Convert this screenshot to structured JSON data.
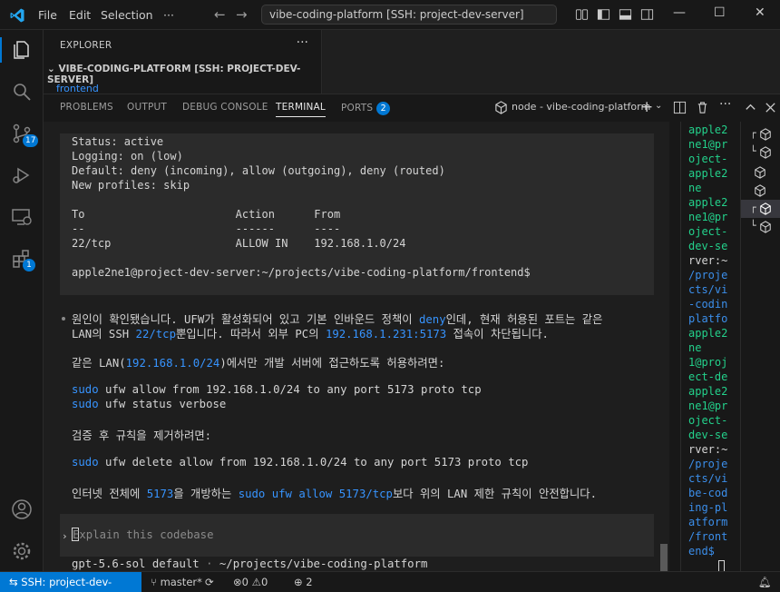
{
  "titlebar": {
    "menu": [
      "File",
      "Edit",
      "Selection"
    ],
    "more": "···",
    "search": "vibe-coding-platform [SSH: project-dev-server]"
  },
  "activity": {
    "scm_badge": "17",
    "ext_badge": "1"
  },
  "sidebar": {
    "header": "EXPLORER",
    "more": "···",
    "project": "VIBE-CODING-PLATFORM [SSH: PROJECT-DEV-SERVER]",
    "folder": "frontend"
  },
  "panel": {
    "tabs": [
      {
        "label": "PROBLEMS"
      },
      {
        "label": "OUTPUT"
      },
      {
        "label": "DEBUG CONSOLE"
      },
      {
        "label": "TERMINAL"
      },
      {
        "label": "PORTS",
        "count": "2"
      }
    ],
    "terminal_name": "node - vibe-coding-platform"
  },
  "content": {
    "codeblock": [
      "Status: active",
      "Logging: on (low)",
      "Default: deny (incoming), allow (outgoing), deny (routed)",
      "New profiles: skip",
      "",
      "To                       Action      From",
      "--                       ------      ----",
      "22/tcp                   ALLOW IN    192.168.1.0/24",
      "",
      "apple2ne1@project-dev-server:~/projects/vibe-coding-platform/frontend$"
    ],
    "p1_a": "원인이 확인됐습니다. UFW가 활성화되어 있고 기본 인바운드 정책이 ",
    "p1_hl1": "deny",
    "p1_b": "인데, 현재 허용된 포트는 같은",
    "p2_a": "LAN의 SSH ",
    "p2_hl1": "22/tcp",
    "p2_b": "뿐입니다. 따라서 외부 PC의 ",
    "p2_hl2": "192.168.1.231:5173",
    "p2_c": " 접속이 차단됩니다.",
    "p3_a": "같은 LAN(",
    "p3_hl": "192.168.1.0/24",
    "p3_b": ")에서만 개발 서버에 접근하도록 허용하려면:",
    "cmd1_sudo": "sudo",
    "cmd1": " ufw allow from 192.168.1.0/24 to any port 5173 proto tcp",
    "cmd2_sudo": "sudo",
    "cmd2": " ufw status verbose",
    "p4": "검증 후 규칙을 제거하려면:",
    "cmd3_sudo": "sudo",
    "cmd3": " ufw delete allow from 192.168.1.0/24 to any port 5173 proto tcp",
    "p5_a": "인터넷 전체에 ",
    "p5_hl1": "5173",
    "p5_b": "을 개방하는 ",
    "p5_hl2": "sudo ufw allow 5173/tcp",
    "p5_c": "보다 위의 LAN 제한 규칙이 안전합니다.",
    "input_placeholder": "Explain this codebase",
    "model": "gpt-5.6-sol default",
    "model_sep": " · ",
    "model_path": "~/projects/vibe-coding-platform"
  },
  "term2": {
    "lines": [
      {
        "t": "apple2",
        "c": "g"
      },
      {
        "t": "ne1@pr",
        "c": "g"
      },
      {
        "t": "oject-",
        "c": "g"
      },
      {
        "t": "apple2",
        "c": "g"
      },
      {
        "t": "ne",
        "c": "g"
      },
      {
        "t": "apple2",
        "c": "g"
      },
      {
        "t": "ne1@pr",
        "c": "g"
      },
      {
        "t": "oject-",
        "c": "g"
      },
      {
        "t": "dev-se",
        "c": "g"
      },
      {
        "t": "rver:~",
        "c": "w"
      },
      {
        "t": "/proje",
        "c": "b"
      },
      {
        "t": "cts/vi",
        "c": "b"
      },
      {
        "t": "-codin",
        "c": "b"
      },
      {
        "t": "platfo",
        "c": "b"
      },
      {
        "t": "apple2",
        "c": "g"
      },
      {
        "t": "ne",
        "c": "g"
      },
      {
        "t": "1@proj",
        "c": "g"
      },
      {
        "t": "ect-de",
        "c": "g"
      },
      {
        "t": "apple2",
        "c": "g"
      },
      {
        "t": "ne1@pr",
        "c": "g"
      },
      {
        "t": "oject-",
        "c": "g"
      },
      {
        "t": "dev-se",
        "c": "g"
      },
      {
        "t": "rver:~",
        "c": "w"
      },
      {
        "t": "/proje",
        "c": "b"
      },
      {
        "t": "cts/vi",
        "c": "b"
      },
      {
        "t": "be-cod",
        "c": "b"
      },
      {
        "t": "ing-pl",
        "c": "b"
      },
      {
        "t": "atform",
        "c": "b"
      },
      {
        "t": "/front",
        "c": "b"
      },
      {
        "t": "end$",
        "c": "b"
      }
    ]
  },
  "statusbar": {
    "remote": "SSH: project-dev-server",
    "branch": "master*",
    "errors": "0",
    "warnings": "0",
    "ports": "2"
  },
  "colors": {
    "accent": "#0078d4",
    "link": "#3794ff",
    "terminal_green": "#23d18b",
    "terminal_blue": "#3b8eea"
  }
}
